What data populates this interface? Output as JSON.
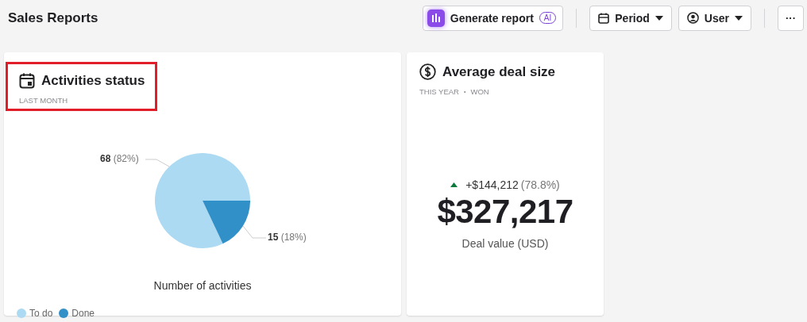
{
  "page": {
    "title": "Sales Reports"
  },
  "toolbar": {
    "generate_button": {
      "label": "Generate report",
      "badge": "AI"
    },
    "period_button": {
      "label": "Period"
    },
    "user_button": {
      "label": "User"
    },
    "more_button": {
      "label": "···"
    }
  },
  "cards": [
    {
      "kind": "pie",
      "title": "Activities status",
      "highlighted": true,
      "subtitle": [
        "LAST MONTH"
      ],
      "chart_data": {
        "type": "pie",
        "categories": [
          "To do",
          "Done"
        ],
        "series": [
          {
            "name": "Number of activities",
            "values": [
              82,
              18
            ]
          }
        ],
        "colors": [
          "#acdaf3",
          "#3290c8"
        ],
        "value_labels": [
          "**68** (82%)",
          "**15** (18%)"
        ]
      }
    },
    {
      "kind": "metric",
      "title": "Average deal size",
      "highlighted": false,
      "subtitle": [
        "THIS YEAR",
        "•",
        "WON"
      ],
      "change": "+$144,212",
      "change_percent": "(78.8%)",
      "value": "$327,217",
      "caption": "Deal value (USD)"
    }
  ]
}
